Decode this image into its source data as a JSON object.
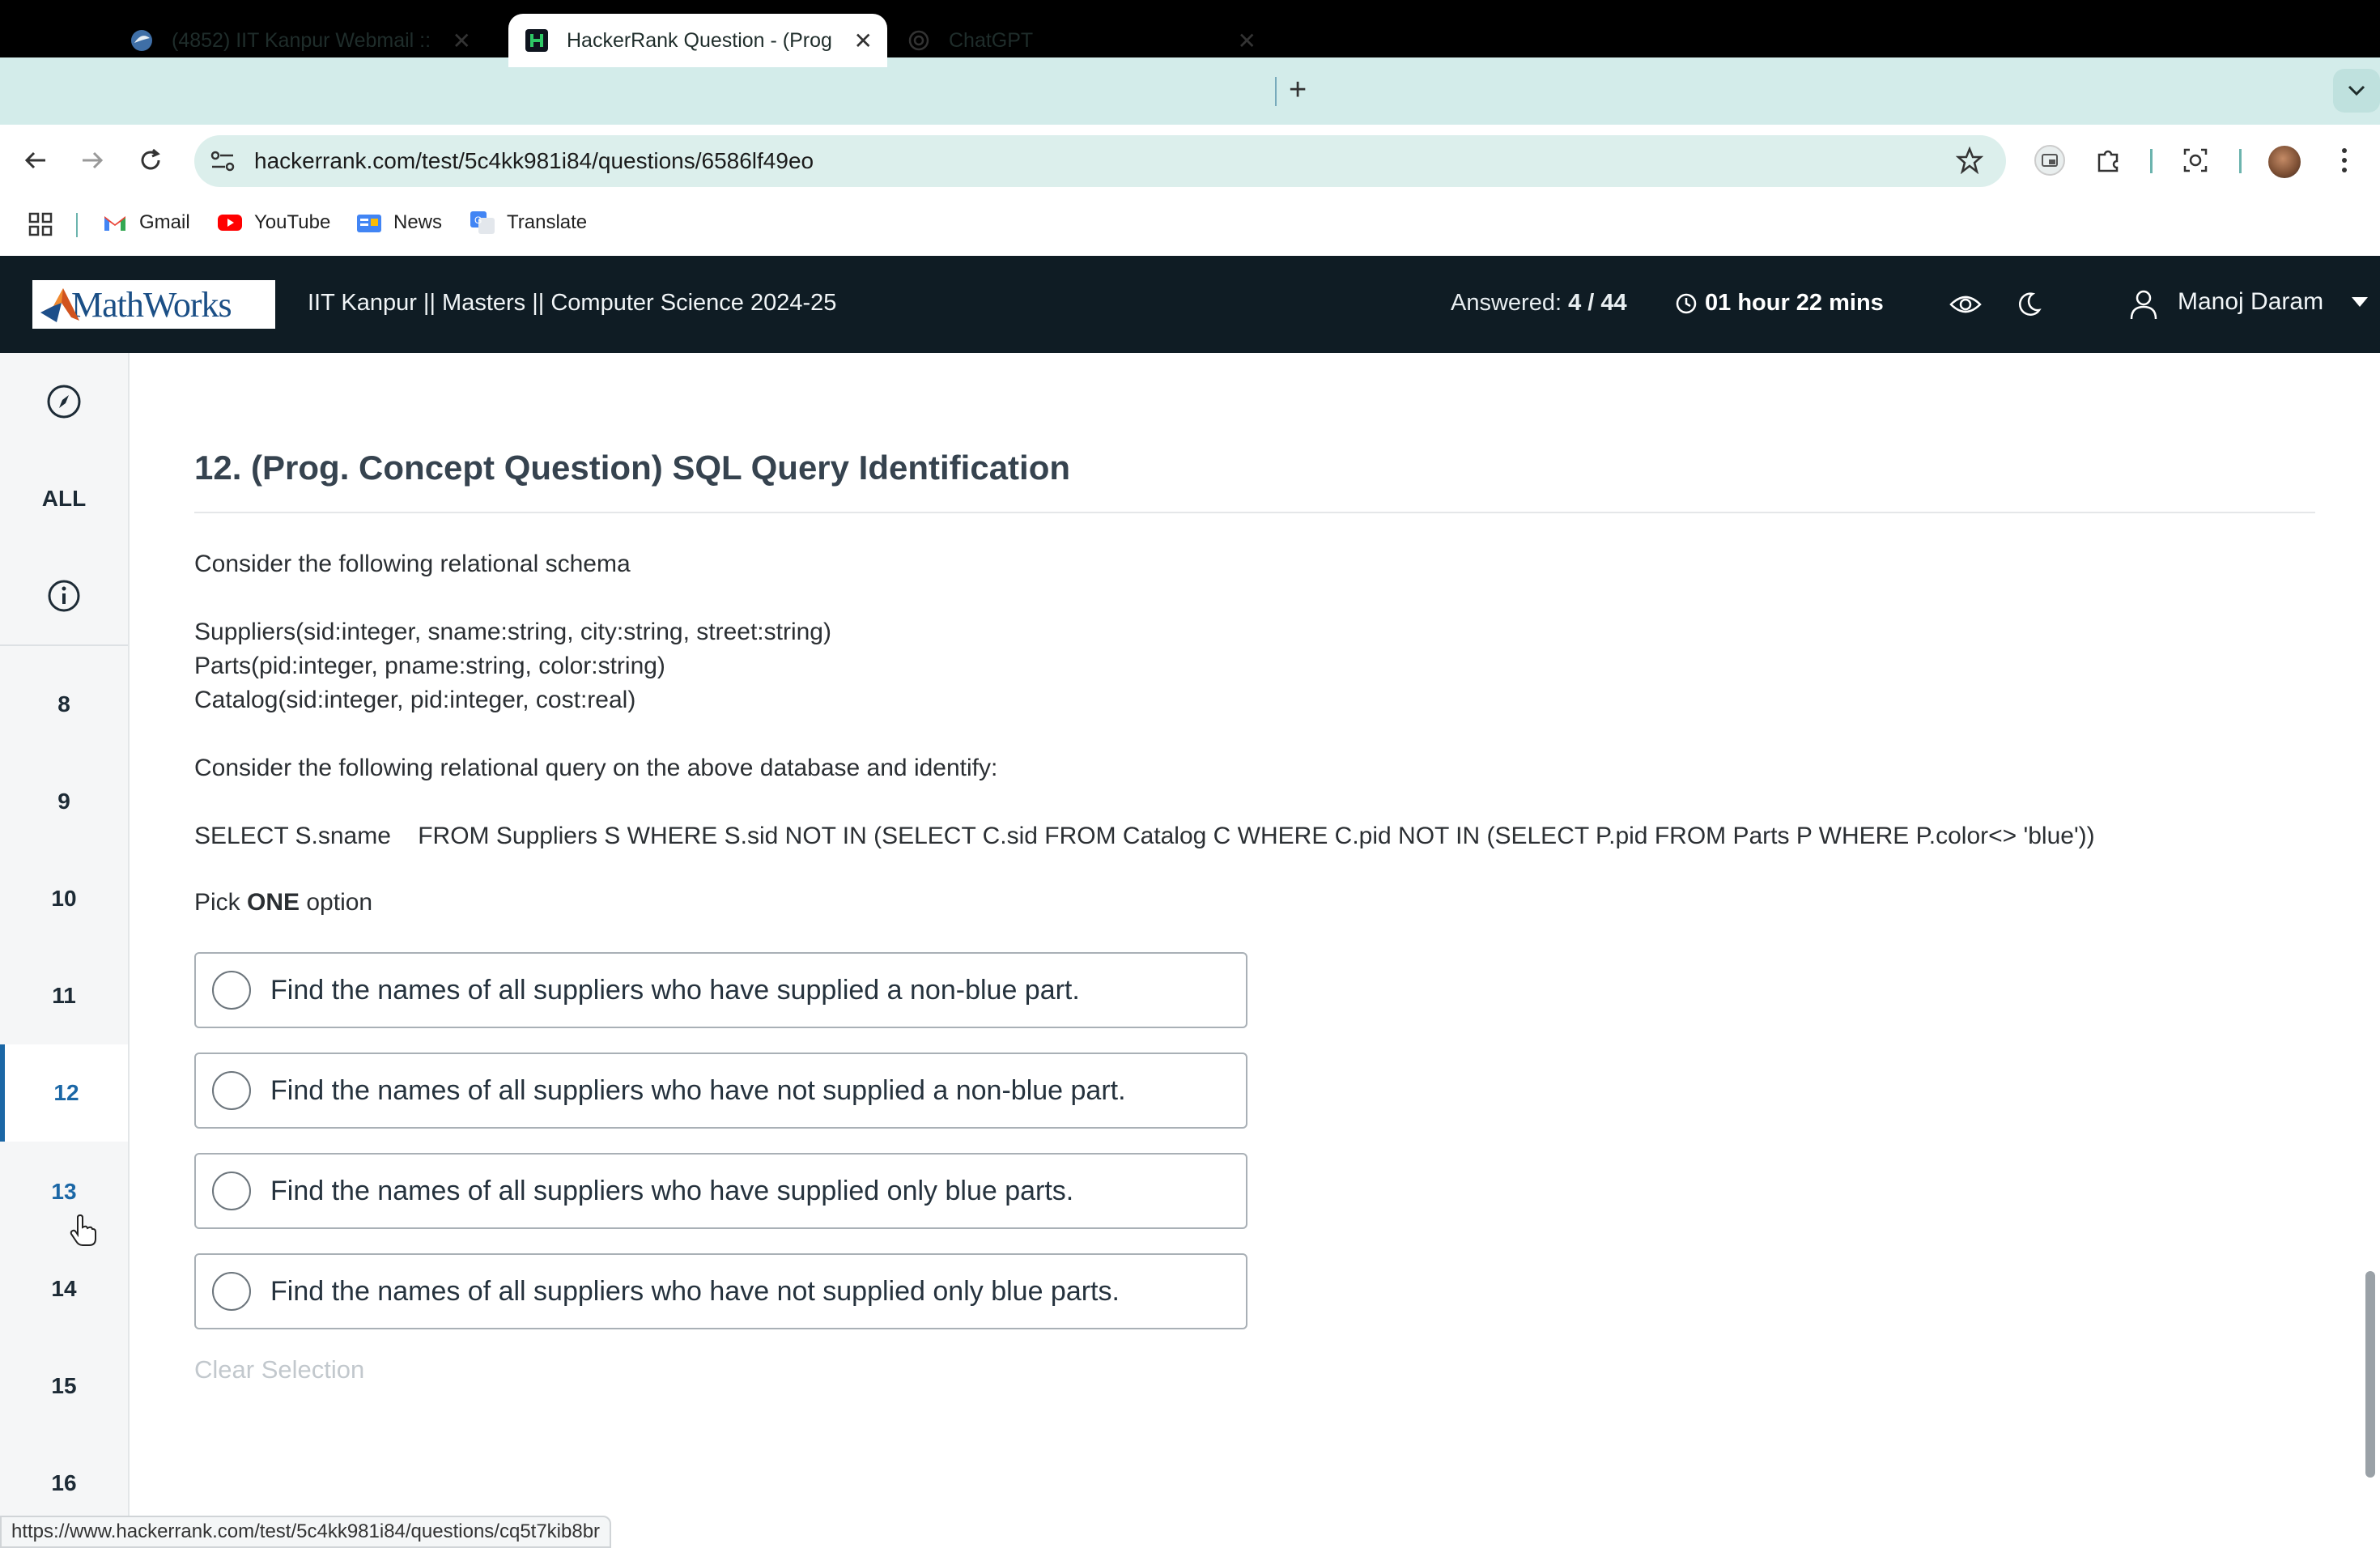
{
  "browser": {
    "tabs": [
      {
        "title": "(4852) IIT Kanpur Webmail ::",
        "favicon": "webmail-icon",
        "active": false
      },
      {
        "title": "HackerRank Question - (Prog",
        "favicon": "hackerrank-icon",
        "active": true
      },
      {
        "title": "ChatGPT",
        "favicon": "chatgpt-icon",
        "active": false
      }
    ],
    "url": "hackerrank.com/test/5c4kk981i84/questions/6586lf49eo",
    "bookmarks": [
      {
        "label": "Gmail",
        "icon": "gmail-icon"
      },
      {
        "label": "YouTube",
        "icon": "youtube-icon"
      },
      {
        "label": "News",
        "icon": "news-icon"
      },
      {
        "label": "Translate",
        "icon": "translate-icon"
      }
    ],
    "status_url": "https://www.hackerrank.com/test/5c4kk981i84/questions/cq5t7kib8br"
  },
  "header": {
    "logo_text": "MathWorks",
    "test_title": "IIT Kanpur || Masters || Computer Science 2024-25",
    "answered_label": "Answered:",
    "answered_value": "4 / 44",
    "timer": "01 hour 22 mins",
    "user_name": "Manoj Daram"
  },
  "sidebar": {
    "all_label": "ALL",
    "questions": [
      "8",
      "9",
      "10",
      "11",
      "12",
      "13",
      "14",
      "15",
      "16"
    ],
    "active": "12"
  },
  "question": {
    "title": "12. (Prog. Concept Question) SQL Query Identification",
    "intro": "Consider the following relational schema",
    "schema": [
      "Suppliers(sid:integer, sname:string, city:string, street:string)",
      "Parts(pid:integer, pname:string, color:string)",
      "Catalog(sid:integer, pid:integer, cost:real)"
    ],
    "prompt": "Consider the following relational query on the above database and identify:",
    "query": "SELECT S.sname    FROM Suppliers S WHERE S.sid NOT IN (SELECT C.sid FROM Catalog C WHERE C.pid NOT IN (SELECT P.pid FROM Parts P WHERE P.color<> 'blue'))",
    "pick_prefix": "Pick ",
    "pick_bold": "ONE",
    "pick_suffix": " option",
    "options": [
      "Find the names of all suppliers who have supplied a non-blue part.",
      "Find the names of all suppliers who have not supplied a non-blue part.",
      "Find the names of all suppliers who have supplied only blue parts.",
      "Find the names of all suppliers who have not supplied only blue parts."
    ],
    "clear_label": "Clear Selection"
  },
  "colors": {
    "header_bg": "#0f1c24",
    "accent": "#1b67a6",
    "tabstrip": "#d3ecea"
  }
}
